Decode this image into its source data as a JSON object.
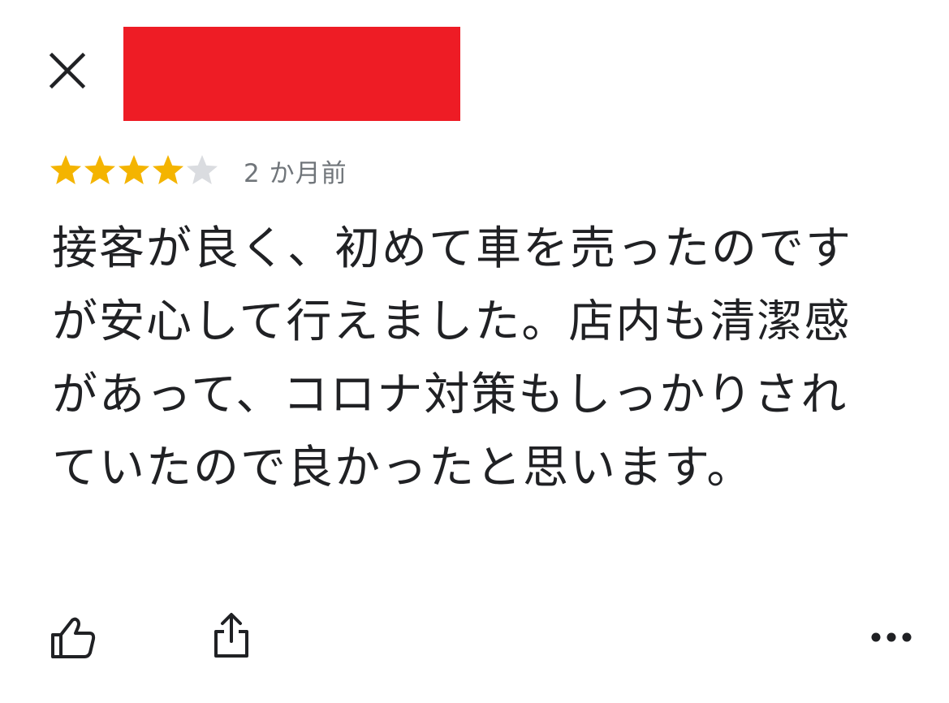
{
  "header": {
    "close_icon": "close-icon",
    "redaction_color": "#ee1c25"
  },
  "review": {
    "rating": 4,
    "max_rating": 5,
    "star_filled_color": "#f4b400",
    "star_empty_color": "#dadce0",
    "timestamp": "2 か月前",
    "text": "接客が良く、初めて車を売ったのですが安心して行えました。店内も清潔感があって、コロナ対策もしっかりされていたので良かったと思います。"
  },
  "actions": {
    "like_icon": "thumbs-up-icon",
    "share_icon": "share-icon",
    "more_icon": "more-horizontal-icon"
  }
}
